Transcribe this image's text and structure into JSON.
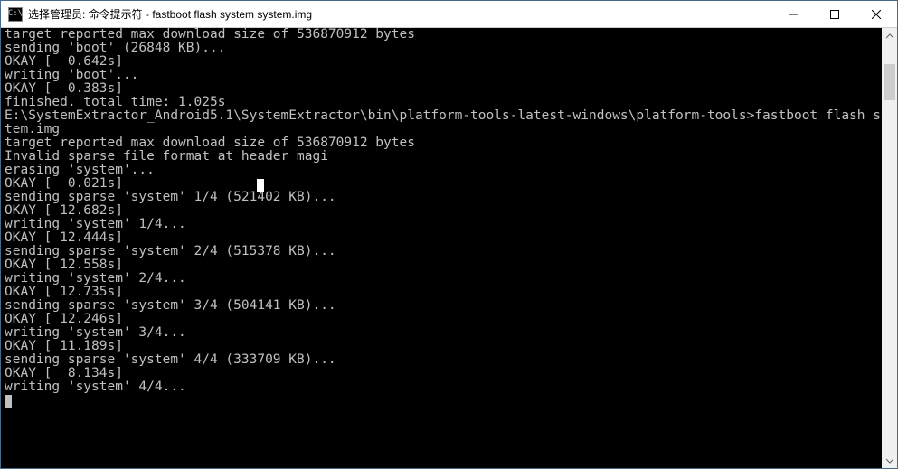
{
  "window": {
    "icon_text": "C:\\",
    "title": "选择管理员: 命令提示符 - fastboot  flash system system.img"
  },
  "terminal": {
    "l0": "target reported max download size of 536870912 bytes",
    "l1": "sending 'boot' (26848 KB)...",
    "l2": "OKAY [  0.642s]",
    "l3": "writing 'boot'...",
    "l4": "OKAY [  0.383s]",
    "l5": "finished. total time: 1.025s",
    "l6": "",
    "l7a": "E:\\SystemExtractor_Android5.1\\SystemExtractor\\bin\\platform-tools-latest-windows\\platform-tools>fastboot flash system sys",
    "l7b": "tem.img",
    "l8": "target reported max download size of 536870912 bytes",
    "l9": "Invalid sparse file format at header magi",
    "l10": "erasing 'system'...",
    "l11a": "OKAY [  0.021s]",
    "l11b": "                 ",
    "l12": "sending sparse 'system' 1/4 (521402 KB)...",
    "l13": "OKAY [ 12.682s]",
    "l14": "writing 'system' 1/4...",
    "l15": "OKAY [ 12.444s]",
    "l16": "sending sparse 'system' 2/4 (515378 KB)...",
    "l17": "OKAY [ 12.558s]",
    "l18": "writing 'system' 2/4...",
    "l19": "OKAY [ 12.735s]",
    "l20": "sending sparse 'system' 3/4 (504141 KB)...",
    "l21": "OKAY [ 12.246s]",
    "l22": "writing 'system' 3/4...",
    "l23": "OKAY [ 11.189s]",
    "l24": "sending sparse 'system' 4/4 (333709 KB)...",
    "l25": "OKAY [  8.134s]",
    "l26": "writing 'system' 4/4..."
  }
}
